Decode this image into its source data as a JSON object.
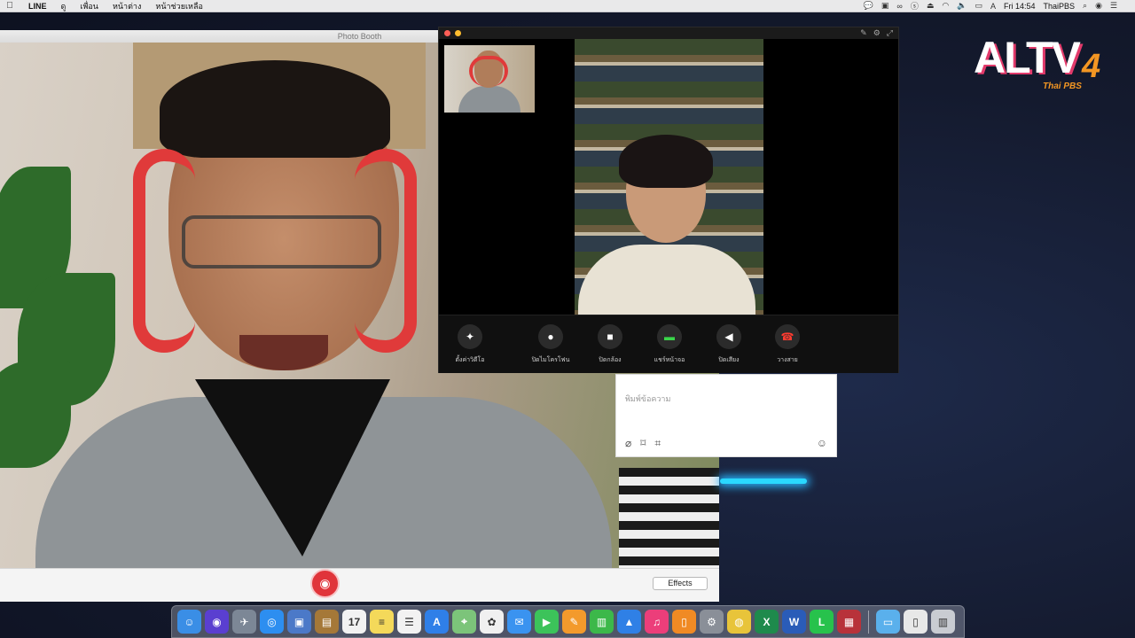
{
  "menubar": {
    "apple": "",
    "app_name": "LINE",
    "menus": [
      "ดู",
      "เพื่อน",
      "หน้าต่าง",
      "หน้าช่วยเหลือ"
    ],
    "clock": "Fri 14:54",
    "user": "ThaiPBS",
    "status_icons": [
      "line-status-icon",
      "screen-share-icon",
      "creative-cloud-icon",
      "skype-icon",
      "airplay-icon",
      "wifi-icon",
      "volume-icon",
      "battery-icon",
      "input-source-icon",
      "clock",
      "user",
      "spotlight-icon",
      "siri-icon",
      "notification-center-icon"
    ]
  },
  "logo": {
    "text": "ALTV",
    "number": "4",
    "subtitle": "Thai PBS"
  },
  "photobooth": {
    "title": "Photo Booth",
    "shutter_icon": "camera-icon",
    "effects_label": "Effects"
  },
  "chat": {
    "placeholder": "พิมพ์ข้อความ",
    "tools": [
      "paperclip-icon",
      "bookmark-icon",
      "crop-icon"
    ],
    "emoji_icon": "emoji-icon"
  },
  "call": {
    "title_icons": [
      "pin-icon",
      "gear-icon",
      "fullscreen-icon"
    ],
    "controls": [
      {
        "icon": "sparkle-icon",
        "glyph": "✦",
        "label": "ตั้งค่าวิดีโอ",
        "style": ""
      },
      {
        "icon": "microphone-icon",
        "glyph": "🎙",
        "label": "ปิดไมโครโฟน",
        "style": ""
      },
      {
        "icon": "video-camera-icon",
        "glyph": "■",
        "label": "ปิดกล้อง",
        "style": ""
      },
      {
        "icon": "screen-share-icon",
        "glyph": "▬",
        "label": "แชร์หน้าจอ",
        "style": "green"
      },
      {
        "icon": "speaker-icon",
        "glyph": "🔊",
        "label": "ปิดเสียง",
        "style": ""
      },
      {
        "icon": "hang-up-icon",
        "glyph": "☎",
        "label": "วางสาย",
        "style": "red"
      }
    ]
  },
  "dock": {
    "apps": [
      {
        "name": "finder-icon",
        "glyph": "☺",
        "color": "#3a8ee6"
      },
      {
        "name": "siri-icon",
        "glyph": "◉",
        "color": "#5a3fd0"
      },
      {
        "name": "launchpad-icon",
        "glyph": "✈",
        "color": "#7c8796"
      },
      {
        "name": "safari-icon",
        "glyph": "◎",
        "color": "#2d8ef0"
      },
      {
        "name": "preview-icon",
        "glyph": "▣",
        "color": "#4b79c8"
      },
      {
        "name": "notefile-icon",
        "glyph": "▤",
        "color": "#a57838"
      },
      {
        "name": "calendar-icon",
        "glyph": "17",
        "color": "#f2f2f2"
      },
      {
        "name": "notes-icon",
        "glyph": "≡",
        "color": "#f4d95a"
      },
      {
        "name": "reminders-icon",
        "glyph": "☰",
        "color": "#f2f2f2"
      },
      {
        "name": "app-store-icon",
        "glyph": "A",
        "color": "#2f7fe8"
      },
      {
        "name": "maps-icon",
        "glyph": "⌖",
        "color": "#7cc47a"
      },
      {
        "name": "photos-icon",
        "glyph": "✿",
        "color": "#f0f0f0"
      },
      {
        "name": "messages-icon",
        "glyph": "✉",
        "color": "#3a93f0"
      },
      {
        "name": "facetime-icon",
        "glyph": "▶",
        "color": "#3cc35a"
      },
      {
        "name": "pages-icon",
        "glyph": "✎",
        "color": "#f39a2c"
      },
      {
        "name": "numbers-icon",
        "glyph": "▥",
        "color": "#3cb84a"
      },
      {
        "name": "keynote-icon",
        "glyph": "▲",
        "color": "#2f80e6"
      },
      {
        "name": "itunes-icon",
        "glyph": "♫",
        "color": "#ec3e7a"
      },
      {
        "name": "ibooks-icon",
        "glyph": "▯",
        "color": "#f08a24"
      },
      {
        "name": "system-preferences-icon",
        "glyph": "⚙",
        "color": "#8a8f98"
      },
      {
        "name": "chrome-icon",
        "glyph": "◍",
        "color": "#e8c43a"
      },
      {
        "name": "excel-icon",
        "glyph": "X",
        "color": "#1e8a4c"
      },
      {
        "name": "word-icon",
        "glyph": "W",
        "color": "#2a5cb8"
      },
      {
        "name": "line-icon",
        "glyph": "L",
        "color": "#27c24c"
      },
      {
        "name": "photo-booth-icon",
        "glyph": "▦",
        "color": "#b8323a"
      }
    ],
    "right_apps": [
      {
        "name": "downloads-folder-icon",
        "glyph": "▭",
        "color": "#5ab0ec"
      },
      {
        "name": "document-icon",
        "glyph": "▯",
        "color": "#e8e8e8"
      },
      {
        "name": "trash-icon",
        "glyph": "▥",
        "color": "#c9ccd2"
      }
    ]
  }
}
